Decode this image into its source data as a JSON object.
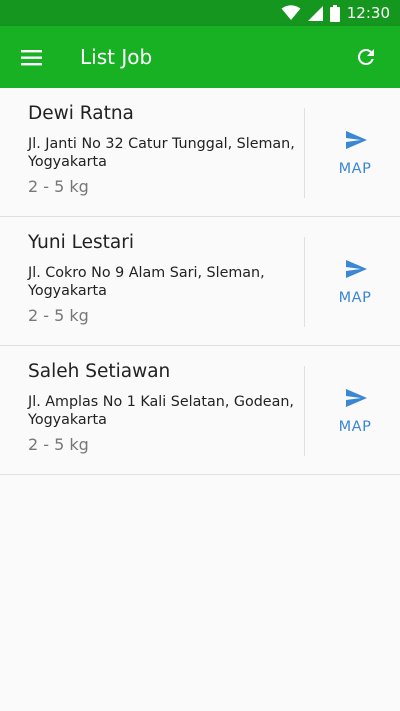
{
  "status_bar": {
    "time": "12:30",
    "icons": [
      "wifi-icon",
      "cellular-signal-icon",
      "battery-icon"
    ]
  },
  "app_bar": {
    "title": "List Job",
    "menu_icon": "menu-icon",
    "refresh_icon": "refresh-icon"
  },
  "jobs": [
    {
      "name": "Dewi Ratna",
      "address": "Jl. Janti No 32 Catur Tunggal, Sleman, Yogyakarta",
      "weight": "2 - 5 kg",
      "map_label": "MAP"
    },
    {
      "name": "Yuni Lestari",
      "address": "Jl. Cokro No 9 Alam Sari, Sleman, Yogyakarta",
      "weight": "2 - 5 kg",
      "map_label": "MAP"
    },
    {
      "name": "Saleh Setiawan",
      "address": "Jl. Amplas No 1 Kali Selatan, Godean, Yogyakarta",
      "weight": "2 - 5 kg",
      "map_label": "MAP"
    }
  ],
  "colors": {
    "status_bar": "#15961f",
    "app_bar": "#19b124",
    "accent": "#3b87d4"
  }
}
